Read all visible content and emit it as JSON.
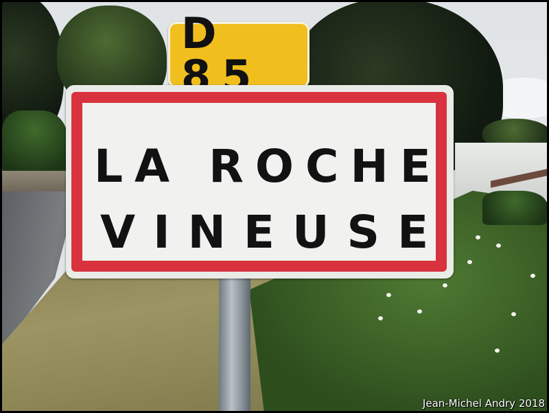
{
  "route_sign": {
    "text": "D85",
    "display": "D 85"
  },
  "town_sign": {
    "line1": "LA ROCHE",
    "line2": "VINEUSE"
  },
  "credit": "Jean-Michel Andry 2018",
  "colors": {
    "route_sign_yellow": "#f1bf1d",
    "town_sign_border_red": "#d8323e",
    "town_sign_background": "#f1f2ef",
    "lettering": "#121212"
  }
}
